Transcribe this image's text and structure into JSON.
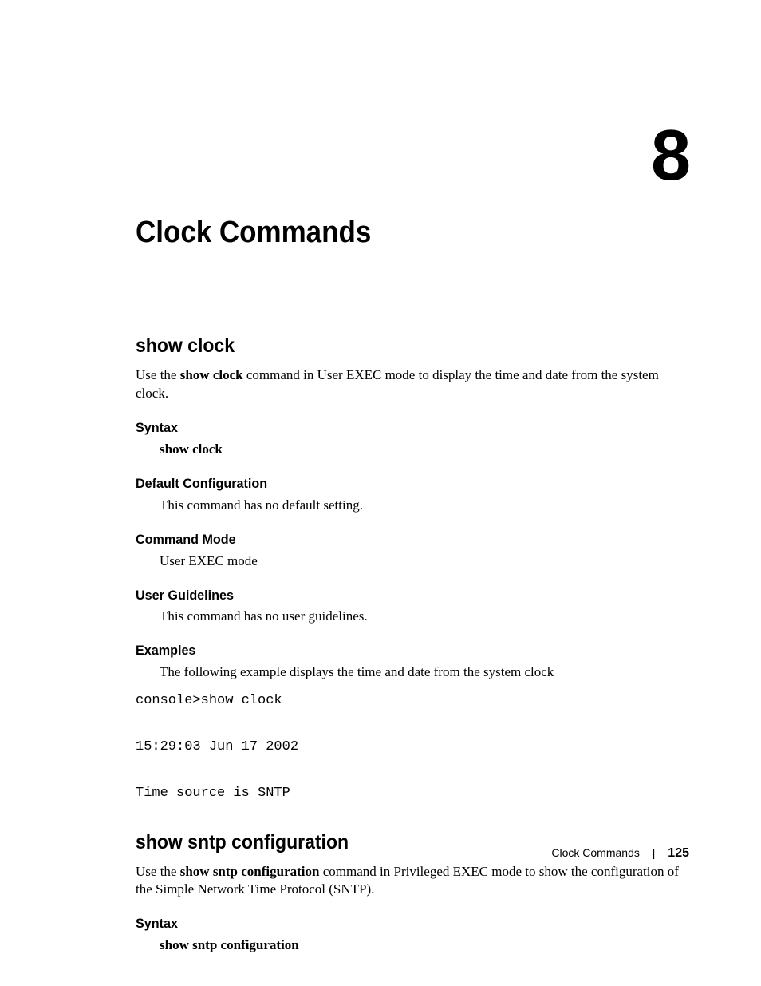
{
  "chapter": {
    "number": "8",
    "title": "Clock Commands"
  },
  "sections": [
    {
      "title": "show clock",
      "intro_pre": "Use the ",
      "intro_bold": "show clock",
      "intro_post": "  command in User EXEC mode to display the time and date from the system clock.",
      "subs": {
        "syntax_h": "Syntax",
        "syntax_body": "show clock",
        "default_h": "Default Configuration",
        "default_body": "This command has no default setting.",
        "mode_h": "Command Mode",
        "mode_body": "User EXEC mode",
        "guidelines_h": "User Guidelines",
        "guidelines_body": "This command has no user guidelines.",
        "examples_h": "Examples",
        "examples_body": "The following example displays the time and date from the system clock",
        "examples_code": "console>show clock\n\n15:29:03 Jun 17 2002\n\nTime source is SNTP"
      }
    },
    {
      "title": "show sntp configuration",
      "intro_pre": "Use the ",
      "intro_bold": "show sntp configuration",
      "intro_post": " command in Privileged EXEC mode to show the configuration of the Simple Network Time Protocol (SNTP).",
      "subs": {
        "syntax_h": "Syntax",
        "syntax_body": "show sntp configuration"
      }
    }
  ],
  "footer": {
    "section_name": "Clock Commands",
    "page_number": "125"
  }
}
